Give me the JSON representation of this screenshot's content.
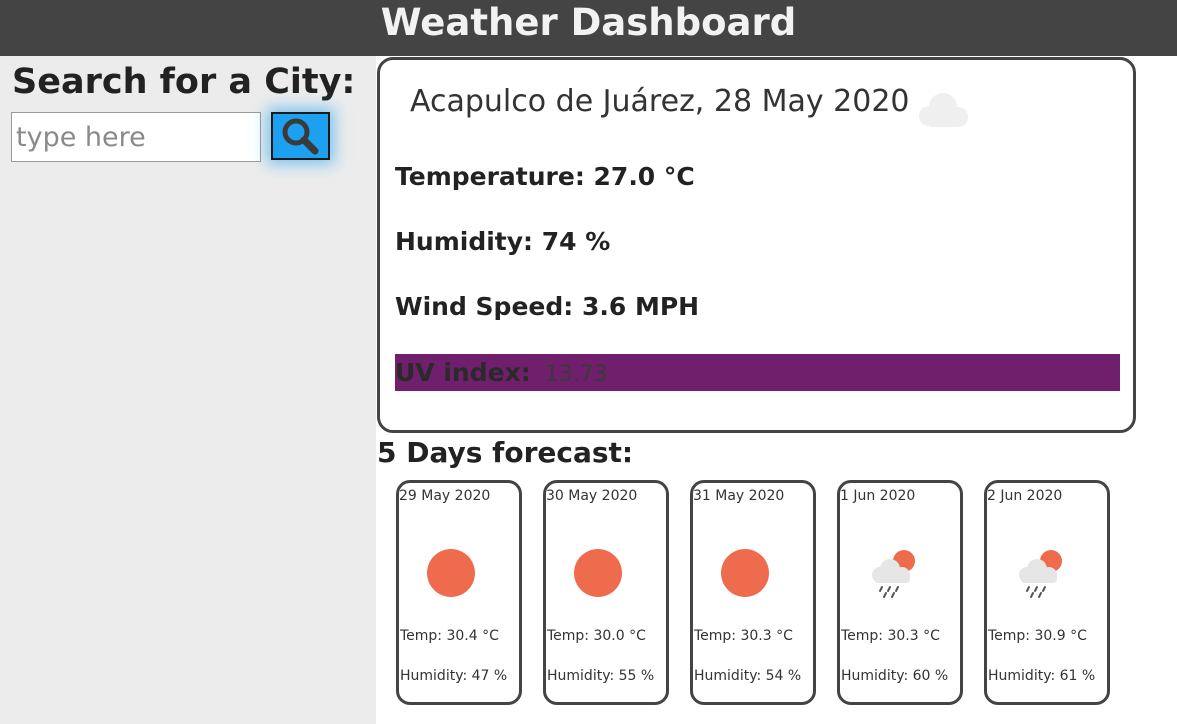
{
  "header": {
    "title": "Weather Dashboard"
  },
  "search": {
    "title": "Search for a City:",
    "placeholder": "type here",
    "button_icon": "search-icon"
  },
  "current": {
    "city_date": "Acapulco de Juárez, 28 May 2020",
    "icon": "cloud-icon",
    "temperature": "Temperature: 27.0 °C",
    "humidity": "Humidity: 74 %",
    "wind": "Wind Speed: 3.6 MPH",
    "uv_label": "UV index:",
    "uv_value": "13.73",
    "uv_color": "#6f1f6b"
  },
  "forecast": {
    "title": "5 Days forecast:",
    "days": [
      {
        "date": "29 May 2020",
        "icon": "sun-icon",
        "temp": "Temp: 30.4 °C",
        "humidity": "Humidity: 47 %"
      },
      {
        "date": "30 May 2020",
        "icon": "sun-icon",
        "temp": "Temp: 30.0 °C",
        "humidity": "Humidity: 55 %"
      },
      {
        "date": "31 May 2020",
        "icon": "sun-icon",
        "temp": "Temp: 30.3 °C",
        "humidity": "Humidity: 54 %"
      },
      {
        "date": "1 Jun 2020",
        "icon": "rain-sun-icon",
        "temp": "Temp: 30.3 °C",
        "humidity": "Humidity: 60 %"
      },
      {
        "date": "2 Jun 2020",
        "icon": "rain-sun-icon",
        "temp": "Temp: 30.9 °C",
        "humidity": "Humidity: 61 %"
      }
    ]
  },
  "colors": {
    "header_bg": "#444444",
    "sidebar_bg": "#ececec",
    "search_button": "#1ea0f0",
    "sun": "#ee6c4d"
  }
}
